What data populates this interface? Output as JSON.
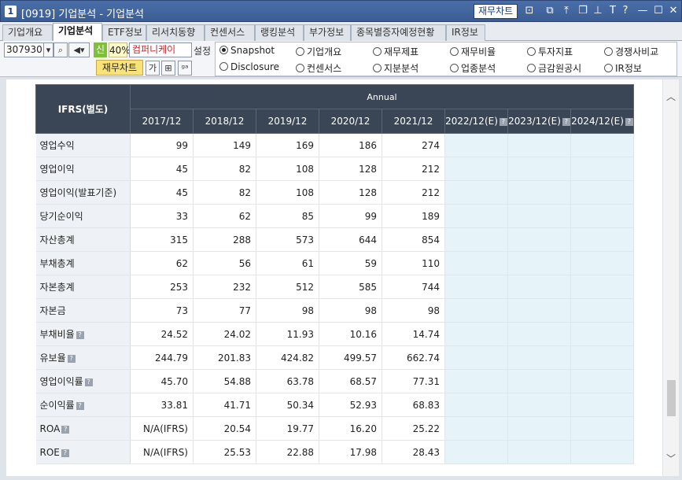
{
  "window": {
    "number": "1",
    "title": "[0919] 기업분석 - 기업분석",
    "chart_button": "재무차트"
  },
  "tabs": [
    "기업개요",
    "기업분석",
    "ETF정보",
    "리서치동향",
    "컨센서스",
    "랭킹분석",
    "부가정보",
    "종목별증자예정현황",
    "IR정보"
  ],
  "active_tab": "기업분석",
  "toolbar": {
    "stock_code": "307930",
    "new_badge": "신",
    "percent": "40%",
    "company_name": "컴퍼니케이",
    "setting_label": "설정",
    "chart_button": "재무차트",
    "radios": [
      {
        "label": "Snapshot",
        "selected": true
      },
      {
        "label": "기업개요",
        "selected": false
      },
      {
        "label": "재무제표",
        "selected": false
      },
      {
        "label": "재무비율",
        "selected": false
      },
      {
        "label": "투자지표",
        "selected": false
      },
      {
        "label": "경쟁사비교",
        "selected": false
      },
      {
        "label": "Disclosure",
        "selected": false
      },
      {
        "label": "컨센서스",
        "selected": false
      },
      {
        "label": "지분분석",
        "selected": false
      },
      {
        "label": "업종분석",
        "selected": false
      },
      {
        "label": "금감원공시",
        "selected": false
      },
      {
        "label": "IR정보",
        "selected": false
      }
    ]
  },
  "table": {
    "row_header": "IFRS(별도)",
    "group_header": "Annual",
    "columns": [
      "2017/12",
      "2018/12",
      "2019/12",
      "2020/12",
      "2021/12",
      "2022/12(E)",
      "2023/12(E)",
      "2024/12(E)"
    ],
    "rows": [
      {
        "label": "영업수익",
        "help": false,
        "values": [
          "99",
          "149",
          "169",
          "186",
          "274",
          "",
          "",
          ""
        ]
      },
      {
        "label": "영업이익",
        "help": false,
        "values": [
          "45",
          "82",
          "108",
          "128",
          "212",
          "",
          "",
          ""
        ]
      },
      {
        "label": "영업이익(발표기준)",
        "help": false,
        "values": [
          "45",
          "82",
          "108",
          "128",
          "212",
          "",
          "",
          ""
        ]
      },
      {
        "label": "당기순이익",
        "help": false,
        "values": [
          "33",
          "62",
          "85",
          "99",
          "189",
          "",
          "",
          ""
        ]
      },
      {
        "label": "자산총계",
        "help": false,
        "values": [
          "315",
          "288",
          "573",
          "644",
          "854",
          "",
          "",
          ""
        ]
      },
      {
        "label": "부채총계",
        "help": false,
        "values": [
          "62",
          "56",
          "61",
          "59",
          "110",
          "",
          "",
          ""
        ]
      },
      {
        "label": "자본총계",
        "help": false,
        "values": [
          "253",
          "232",
          "512",
          "585",
          "744",
          "",
          "",
          ""
        ]
      },
      {
        "label": "자본금",
        "help": false,
        "values": [
          "73",
          "77",
          "98",
          "98",
          "98",
          "",
          "",
          ""
        ]
      },
      {
        "label": "부채비율",
        "help": true,
        "values": [
          "24.52",
          "24.02",
          "11.93",
          "10.16",
          "14.74",
          "",
          "",
          ""
        ]
      },
      {
        "label": "유보율",
        "help": true,
        "values": [
          "244.79",
          "201.83",
          "424.82",
          "499.57",
          "662.74",
          "",
          "",
          ""
        ]
      },
      {
        "label": "영업이익률",
        "help": true,
        "values": [
          "45.70",
          "54.88",
          "63.78",
          "68.57",
          "77.31",
          "",
          "",
          ""
        ]
      },
      {
        "label": "순이익률",
        "help": true,
        "values": [
          "33.81",
          "41.71",
          "50.34",
          "52.93",
          "68.83",
          "",
          "",
          ""
        ]
      },
      {
        "label": "ROA",
        "help": true,
        "values": [
          "N/A(IFRS)",
          "20.54",
          "19.77",
          "16.20",
          "25.22",
          "",
          "",
          ""
        ]
      },
      {
        "label": "ROE",
        "help": true,
        "values": [
          "N/A(IFRS)",
          "25.53",
          "22.88",
          "17.98",
          "28.43",
          "",
          "",
          ""
        ]
      }
    ]
  }
}
